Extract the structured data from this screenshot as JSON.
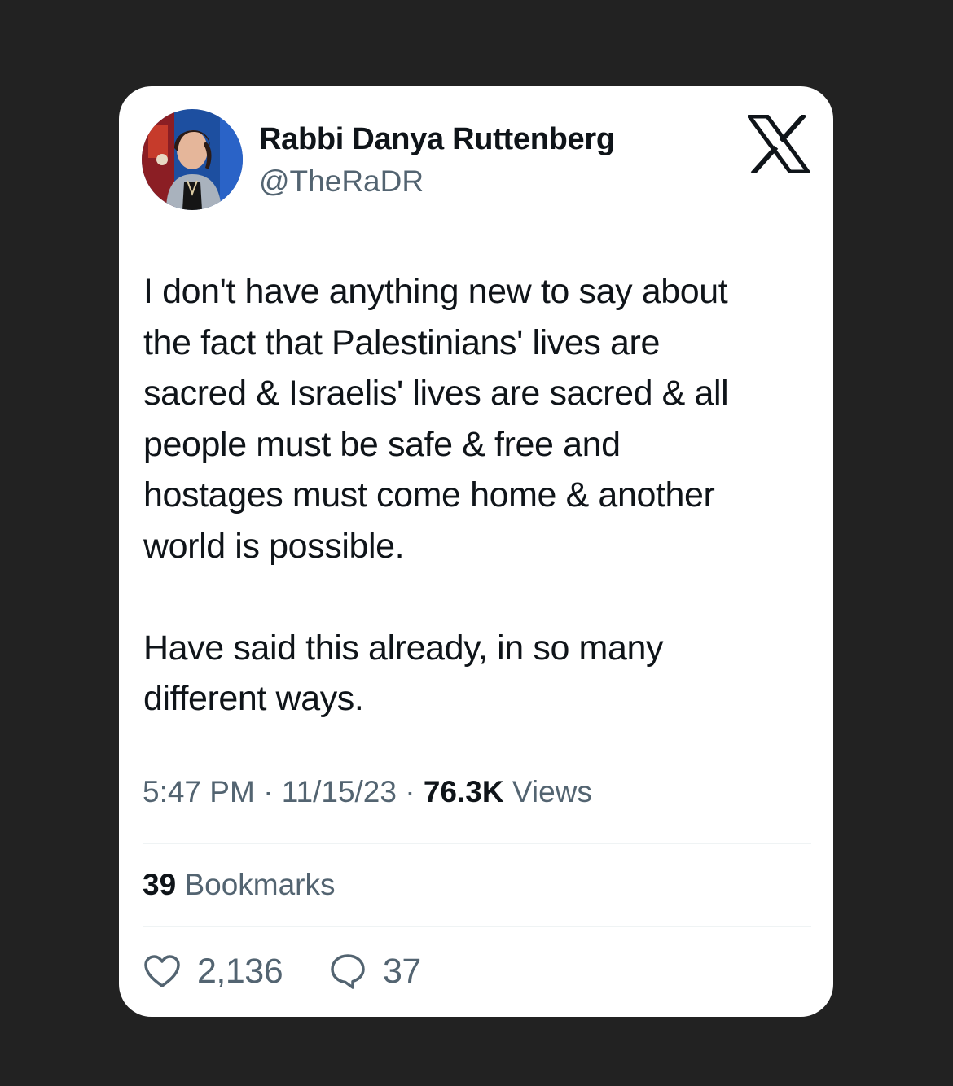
{
  "author": {
    "display_name": "Rabbi Danya Ruttenberg",
    "handle": "@TheRaDR"
  },
  "tweet": {
    "paragraph_1_lines": [
      "I don't have anything new to say about",
      "the fact that Palestinians' lives are",
      "sacred & Israelis' lives are sacred & all",
      "people must be safe & free and",
      "hostages must come home & another",
      "world is possible."
    ],
    "paragraph_2_lines": [
      "Have said this already, in so many",
      "different ways."
    ]
  },
  "meta": {
    "time": "5:47 PM",
    "separator": "·",
    "date": "11/15/23",
    "views_count": "76.3K",
    "views_label": "Views"
  },
  "bookmarks": {
    "count": "39",
    "label": "Bookmarks"
  },
  "actions": {
    "likes": "2,136",
    "replies": "37"
  },
  "icons": {
    "brand": "x-logo-icon",
    "like": "heart-icon",
    "reply": "reply-bubble-icon"
  },
  "colors": {
    "background": "#222222",
    "card": "#ffffff",
    "text": "#0f1419",
    "secondary_text": "#536471",
    "divider": "#eff3f4"
  }
}
